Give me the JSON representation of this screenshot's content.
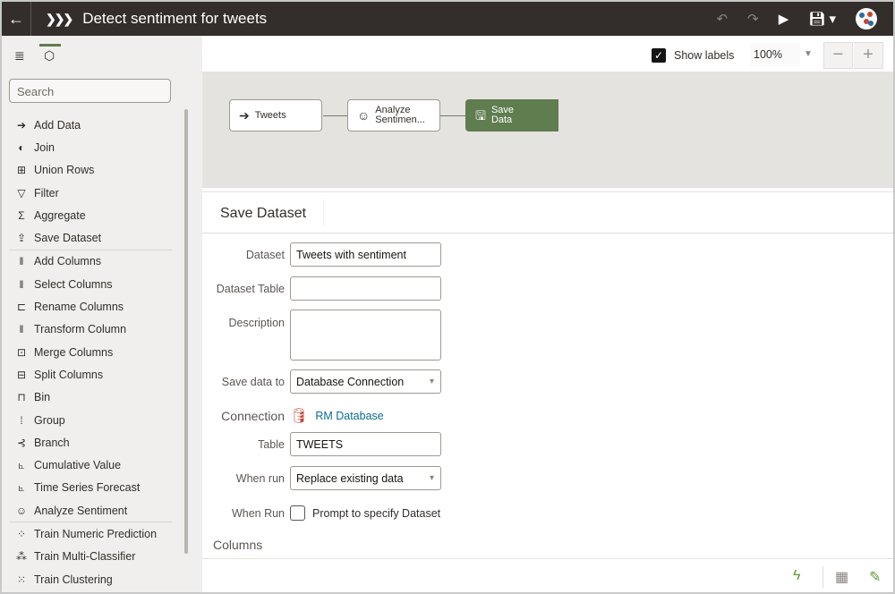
{
  "titlebar": {
    "title": "Detect sentiment for tweets"
  },
  "sidebar": {
    "search_placeholder": "Search",
    "groups": [
      [
        {
          "label": "Add Data",
          "icon": "arrow-circle-right-icon"
        },
        {
          "label": "Join",
          "icon": "join-icon"
        },
        {
          "label": "Union Rows",
          "icon": "union-rows-icon"
        },
        {
          "label": "Filter",
          "icon": "filter-icon"
        },
        {
          "label": "Aggregate",
          "icon": "sigma-icon"
        },
        {
          "label": "Save Dataset",
          "icon": "upload-icon"
        }
      ],
      [
        {
          "label": "Add Columns",
          "icon": "add-columns-icon"
        },
        {
          "label": "Select Columns",
          "icon": "select-columns-icon"
        },
        {
          "label": "Rename Columns",
          "icon": "rename-columns-icon"
        },
        {
          "label": "Transform Column",
          "icon": "transform-column-icon"
        },
        {
          "label": "Merge Columns",
          "icon": "merge-columns-icon"
        },
        {
          "label": "Split Columns",
          "icon": "split-columns-icon"
        },
        {
          "label": "Bin",
          "icon": "bin-icon"
        },
        {
          "label": "Group",
          "icon": "group-icon"
        },
        {
          "label": "Branch",
          "icon": "branch-icon"
        },
        {
          "label": "Cumulative Value",
          "icon": "cumulative-chart-icon"
        },
        {
          "label": "Time Series Forecast",
          "icon": "forecast-chart-icon"
        },
        {
          "label": "Analyze Sentiment",
          "icon": "smiley-icon"
        }
      ],
      [
        {
          "label": "Train Numeric Prediction",
          "icon": "scatter-icon"
        },
        {
          "label": "Train Multi-Classifier",
          "icon": "tree-icon"
        },
        {
          "label": "Train Clustering",
          "icon": "cluster-icon"
        }
      ]
    ]
  },
  "toolbar": {
    "show_labels": "Show labels",
    "show_labels_checked": true,
    "zoom": "100%"
  },
  "flow": {
    "nodes": [
      {
        "label": "Tweets"
      },
      {
        "label1": "Analyze",
        "label2": "Sentimen..."
      },
      {
        "label1": "Save",
        "label2": "Data"
      }
    ]
  },
  "colors": {
    "accent": "#5f7d4f",
    "titlebar": "#332e2b",
    "link": "#0a6d8f",
    "db_icon": "#c74634"
  },
  "props": {
    "tab": "Save Dataset",
    "dataset_label": "Dataset",
    "dataset_value": "Tweets with sentiment",
    "table_label": "Dataset Table",
    "table_value": "",
    "description_label": "Description",
    "description_value": "",
    "save_to_label": "Save data to",
    "save_to_value": "Database Connection",
    "connection_label": "Connection",
    "connection_value": "RM Database",
    "db_table_label": "Table",
    "db_table_value": "TWEETS",
    "when_run_label": "When run",
    "when_run_value": "Replace existing data",
    "when_run2_label": "When Run",
    "prompt_label": "Prompt to specify Dataset",
    "prompt_checked": false,
    "columns_label": "Columns"
  }
}
